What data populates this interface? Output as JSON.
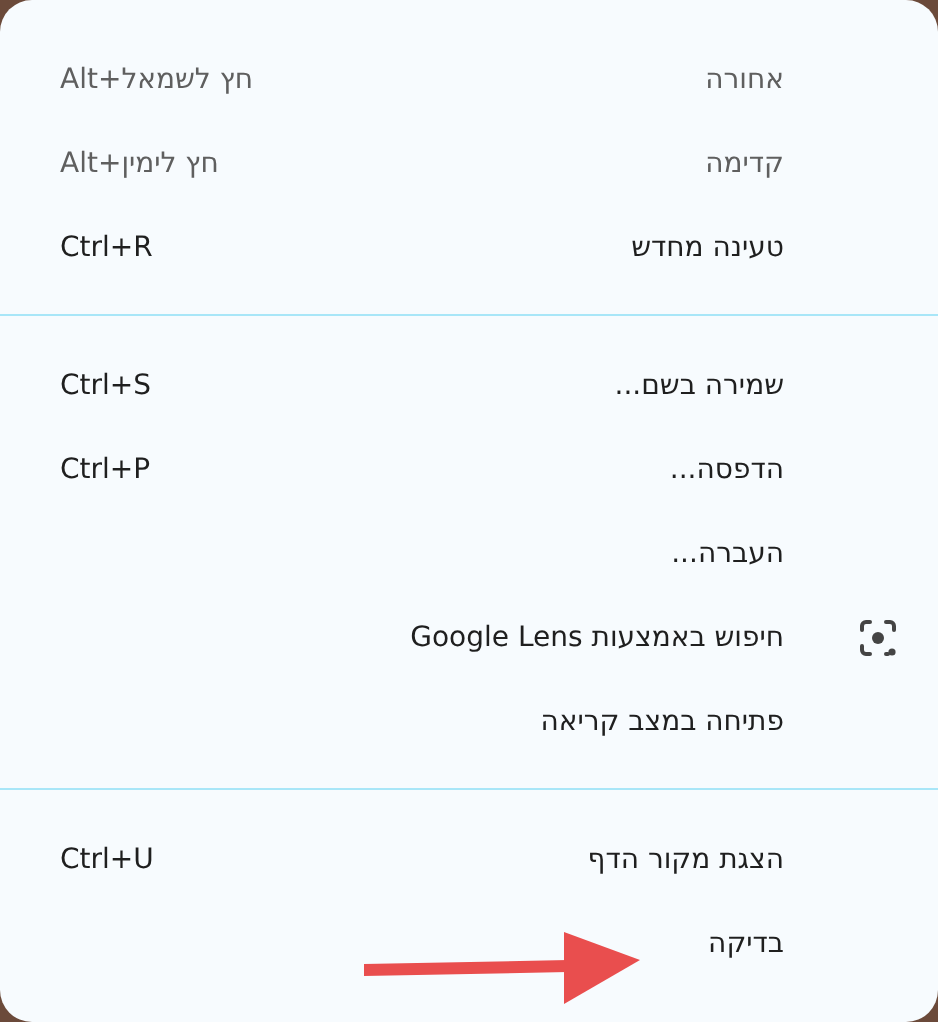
{
  "menu": {
    "sections": [
      {
        "items": [
          {
            "label": "אחורה",
            "shortcut": "Alt+חץ לשמאל",
            "disabled": true
          },
          {
            "label": "קדימה",
            "shortcut": "Alt+חץ לימין",
            "disabled": true
          },
          {
            "label": "טעינה מחדש",
            "shortcut": "Ctrl+R",
            "disabled": false
          }
        ]
      },
      {
        "items": [
          {
            "label": "שמירה בשם...",
            "shortcut": "Ctrl+S",
            "disabled": false
          },
          {
            "label": "הדפסה...",
            "shortcut": "Ctrl+P",
            "disabled": false
          },
          {
            "label": "העברה...",
            "disabled": false
          },
          {
            "label": "חיפוש באמצעות Google Lens",
            "disabled": false,
            "icon": true
          },
          {
            "label": "פתיחה במצב קריאה",
            "disabled": false
          }
        ]
      },
      {
        "items": [
          {
            "label": "הצגת מקור הדף",
            "shortcut": "Ctrl+U",
            "disabled": false
          },
          {
            "label": "בדיקה",
            "disabled": false
          }
        ]
      }
    ]
  }
}
